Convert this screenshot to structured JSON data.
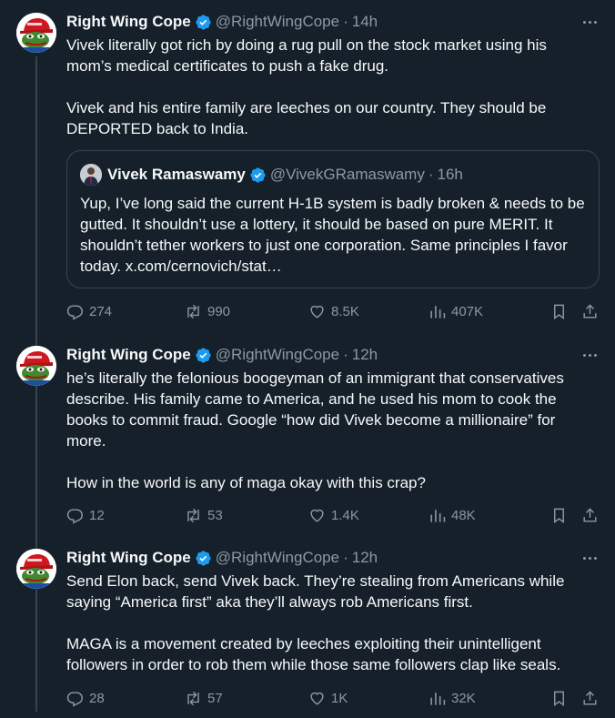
{
  "colors": {
    "background": "#15202b",
    "text": "#f7f9f9",
    "muted": "#8b98a5",
    "verified": "#1d9bf0",
    "border": "#38444d"
  },
  "tweets": [
    {
      "name": "Right Wing Cope",
      "handle": "@RightWingCope",
      "separator": "·",
      "time": "14h",
      "text": "Vivek literally got rich by doing a rug pull on the stock market using his mom’s medical certificates to push a fake drug.\n\nVivek and his entire family are leeches on our country. They should be DEPORTED back to India.",
      "quote": {
        "name": "Vivek Ramaswamy",
        "handle": "@VivekGRamaswamy",
        "separator": "·",
        "time": "16h",
        "text": "Yup, I’ve long said the current H-1B system is badly broken & needs to be gutted. It shouldn’t use a lottery, it should be based on pure MERIT. It shouldn’t tether workers to just one corporation. Same principles I favor today. x.com/cernovich/stat…"
      },
      "stats": {
        "replies": "274",
        "reposts": "990",
        "likes": "8.5K",
        "views": "407K"
      }
    },
    {
      "name": "Right Wing Cope",
      "handle": "@RightWingCope",
      "separator": "·",
      "time": "12h",
      "text": "he’s literally the felonious boogeyman of an immigrant that conservatives describe. His family came to America, and he used his mom to cook the books to commit fraud. Google “how did Vivek become a millionaire” for more.\n\nHow in the world is any of maga okay with this crap?",
      "stats": {
        "replies": "12",
        "reposts": "53",
        "likes": "1.4K",
        "views": "48K"
      }
    },
    {
      "name": "Right Wing Cope",
      "handle": "@RightWingCope",
      "separator": "·",
      "time": "12h",
      "text": "Send Elon back, send Vivek back. They’re stealing from Americans while saying “America first” aka they’ll always rob Americans first.\n\nMAGA is a movement created by leeches exploiting their unintelligent followers in order to rob them while those same followers clap like seals.",
      "stats": {
        "replies": "28",
        "reposts": "57",
        "likes": "1K",
        "views": "32K"
      }
    }
  ]
}
